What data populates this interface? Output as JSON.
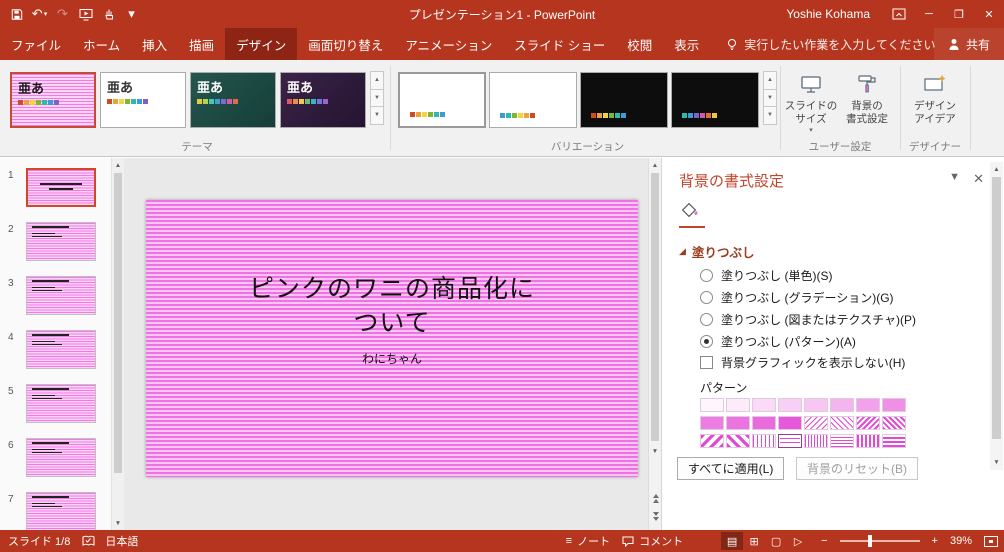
{
  "colors": {
    "title_bar": "#B5351E",
    "active_tab": "#8E2413",
    "ribbon_background": "#F1F1F1",
    "pane_title_red": "#C0452C",
    "selection_orange": "#CC4B2C",
    "pattern_pink": "#E446D6",
    "slide_stripe_dark": "#F070E6",
    "slide_stripe_light": "#F9C6F2"
  },
  "titlebar": {
    "title": "プレゼンテーション1 - PowerPoint",
    "user": "Yoshie Kohama"
  },
  "tabs": [
    {
      "label": "ファイル"
    },
    {
      "label": "ホーム"
    },
    {
      "label": "挿入"
    },
    {
      "label": "描画"
    },
    {
      "label": "デザイン",
      "active": true
    },
    {
      "label": "画面切り替え"
    },
    {
      "label": "アニメーション"
    },
    {
      "label": "スライド ショー"
    },
    {
      "label": "校閲"
    },
    {
      "label": "表示"
    }
  ],
  "tellme": {
    "label": "実行したい作業を入力してください"
  },
  "share": {
    "label": "共有"
  },
  "ribbon": {
    "themes": {
      "label": "テーマ",
      "items": [
        {
          "text": "亜あ",
          "style": "pink-pattern",
          "selected": true,
          "palette": [
            "#D04A23",
            "#E8A33D",
            "#F2D53A",
            "#7FB434",
            "#2FB8AC",
            "#3E9BD6",
            "#8261C5"
          ]
        },
        {
          "text": "亜あ",
          "style": "white",
          "palette": [
            "#D04A23",
            "#E8A33D",
            "#F2D53A",
            "#7FB434",
            "#2FB8AC",
            "#3E9BD6",
            "#8261C5"
          ]
        },
        {
          "text": "亜あ",
          "style": "dark-teal",
          "palette": [
            "#E8C83D",
            "#B5D44A",
            "#4AC6B4",
            "#3E9BD6",
            "#7E6BC9",
            "#C95FA8",
            "#E06A4A"
          ]
        },
        {
          "text": "亜あ",
          "style": "dark-purple",
          "palette": [
            "#E0575F",
            "#E8903D",
            "#EFC94C",
            "#6DBE6A",
            "#41B0C4",
            "#6A7BD4",
            "#A75FC9"
          ]
        }
      ]
    },
    "variants": {
      "label": "バリエーション",
      "items": [
        {
          "style": "white",
          "selected": true,
          "palette": [
            "#D04A23",
            "#E8A33D",
            "#F2D53A",
            "#7FB434",
            "#2FB8AC",
            "#3E9BD6"
          ]
        },
        {
          "style": "white",
          "palette": [
            "#3E9BD6",
            "#2FB8AC",
            "#7FB434",
            "#F2D53A",
            "#E8A33D",
            "#D04A23"
          ]
        },
        {
          "style": "black",
          "palette": [
            "#D04A23",
            "#E8A33D",
            "#F2D53A",
            "#7FB434",
            "#2FB8AC",
            "#3E9BD6"
          ]
        },
        {
          "style": "black",
          "palette": [
            "#2FB8AC",
            "#3E9BD6",
            "#8261C5",
            "#C95FA8",
            "#E06A4A",
            "#E8C83D"
          ]
        }
      ]
    },
    "user_settings": {
      "label": "ユーザー設定",
      "slide_size_line1": "スライドの",
      "slide_size_line2": "サイズ",
      "format_bg_line1": "背景の",
      "format_bg_line2": "書式設定"
    },
    "designer": {
      "label": "デザイナー",
      "design_ideas_line1": "デザイン",
      "design_ideas_line2": "アイデア"
    }
  },
  "slides_panel": {
    "items": [
      {
        "num": "1",
        "selected": true
      },
      {
        "num": "2"
      },
      {
        "num": "3"
      },
      {
        "num": "4"
      },
      {
        "num": "5"
      },
      {
        "num": "6"
      },
      {
        "num": "7"
      }
    ]
  },
  "slide": {
    "title_line1": "ピンクのワニの商品化に",
    "title_line2": "ついて",
    "subtitle": "わにちゃん"
  },
  "pane": {
    "title": "背景の書式設定",
    "fill_section": "塗りつぶし",
    "options": [
      {
        "label": "塗りつぶし (単色)(S)",
        "selected": false
      },
      {
        "label": "塗りつぶし (グラデーション)(G)",
        "selected": false
      },
      {
        "label": "塗りつぶし (図またはテクスチャ)(P)",
        "selected": false
      },
      {
        "label": "塗りつぶし (パターン)(A)",
        "selected": true
      }
    ],
    "hide_bg_checkbox": "背景グラフィックを表示しない(H)",
    "pattern_label": "パターン",
    "patterns": [
      {
        "name": "5%",
        "t": "pct",
        "v": 5
      },
      {
        "name": "10%",
        "t": "pct",
        "v": 10
      },
      {
        "name": "20%",
        "t": "pct",
        "v": 20
      },
      {
        "name": "25%",
        "t": "pct",
        "v": 25
      },
      {
        "name": "30%",
        "t": "pct",
        "v": 30
      },
      {
        "name": "40%",
        "t": "pct",
        "v": 40
      },
      {
        "name": "50%",
        "t": "pct",
        "v": 50
      },
      {
        "name": "60%",
        "t": "pct",
        "v": 60
      },
      {
        "name": "70%",
        "t": "pct",
        "v": 70
      },
      {
        "name": "75%",
        "t": "pct",
        "v": 75
      },
      {
        "name": "80%",
        "t": "pct",
        "v": 80
      },
      {
        "name": "90%",
        "t": "pct",
        "v": 90
      },
      {
        "name": "light-downward-diagonal",
        "t": "diag-down",
        "w": 1,
        "g": 3
      },
      {
        "name": "light-upward-diagonal",
        "t": "diag-up",
        "w": 1,
        "g": 3
      },
      {
        "name": "dark-downward-diagonal",
        "t": "diag-down",
        "w": 2,
        "g": 2
      },
      {
        "name": "dark-upward-diagonal",
        "t": "diag-up",
        "w": 2,
        "g": 2
      },
      {
        "name": "wide-downward-diagonal",
        "t": "diag-down",
        "w": 3,
        "g": 4
      },
      {
        "name": "wide-upward-diagonal",
        "t": "diag-up",
        "w": 3,
        "g": 4
      },
      {
        "name": "light-vertical",
        "t": "vert",
        "w": 1,
        "g": 3
      },
      {
        "name": "light-horizontal",
        "t": "horz",
        "w": 1,
        "g": 3,
        "selected": true
      },
      {
        "name": "narrow-vertical",
        "t": "vert",
        "w": 1,
        "g": 2
      },
      {
        "name": "narrow-horizontal",
        "t": "horz",
        "w": 1,
        "g": 2
      },
      {
        "name": "dark-vertical",
        "t": "vert",
        "w": 2,
        "g": 2
      },
      {
        "name": "dark-horizontal",
        "t": "horz",
        "w": 2,
        "g": 2
      }
    ],
    "apply_all_button": "すべてに適用(L)",
    "reset_button": "背景のリセット(B)"
  },
  "status": {
    "slide_counter": "スライド 1/8",
    "language": "日本語",
    "notes": "ノート",
    "comments": "コメント",
    "zoom": "39%"
  },
  "icons": {
    "undo": "↶",
    "redo": "↷",
    "dropdown": "▾",
    "gallery_up": "▲",
    "gallery_down": "▼",
    "gallery_more": "▼",
    "scroll_up": "▲",
    "scroll_down": "▼",
    "pane_dropdown": "▼",
    "pane_close": "✕",
    "section_expanded": "◢",
    "minimize": "─",
    "maximize": "❐",
    "close": "✕",
    "notes": "≡",
    "view_normal": "▤",
    "view_sorter": "⊞",
    "view_reading": "▢",
    "view_slideshow": "▷",
    "zoom_out": "−",
    "zoom_in": "+"
  }
}
